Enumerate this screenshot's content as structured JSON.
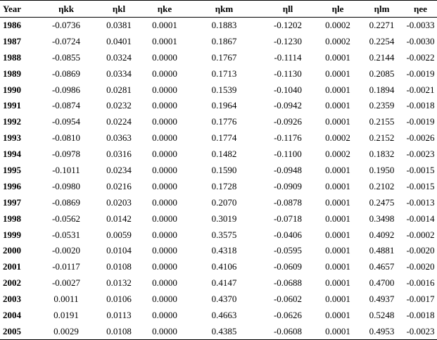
{
  "table": {
    "headers": [
      "Year",
      "ηkk",
      "ηkl",
      "ηke",
      "ηkm",
      "ηll",
      "ηle",
      "ηlm",
      "ηee"
    ],
    "rows": [
      [
        "1986",
        "-0.0736",
        "0.0381",
        "0.0001",
        "0.1883",
        "-0.1202",
        "0.0002",
        "0.2271",
        "-0.0033"
      ],
      [
        "1987",
        "-0.0724",
        "0.0401",
        "0.0001",
        "0.1867",
        "-0.1230",
        "0.0002",
        "0.2254",
        "-0.0030"
      ],
      [
        "1988",
        "-0.0855",
        "0.0324",
        "0.0000",
        "0.1767",
        "-0.1114",
        "0.0001",
        "0.2144",
        "-0.0022"
      ],
      [
        "1989",
        "-0.0869",
        "0.0334",
        "0.0000",
        "0.1713",
        "-0.1130",
        "0.0001",
        "0.2085",
        "-0.0019"
      ],
      [
        "1990",
        "-0.0986",
        "0.0281",
        "0.0000",
        "0.1539",
        "-0.1040",
        "0.0001",
        "0.1894",
        "-0.0021"
      ],
      [
        "1991",
        "-0.0874",
        "0.0232",
        "0.0000",
        "0.1964",
        "-0.0942",
        "0.0001",
        "0.2359",
        "-0.0018"
      ],
      [
        "1992",
        "-0.0954",
        "0.0224",
        "0.0000",
        "0.1776",
        "-0.0926",
        "0.0001",
        "0.2155",
        "-0.0019"
      ],
      [
        "1993",
        "-0.0810",
        "0.0363",
        "0.0000",
        "0.1774",
        "-0.1176",
        "0.0002",
        "0.2152",
        "-0.0026"
      ],
      [
        "1994",
        "-0.0978",
        "0.0316",
        "0.0000",
        "0.1482",
        "-0.1100",
        "0.0002",
        "0.1832",
        "-0.0023"
      ],
      [
        "1995",
        "-0.1011",
        "0.0234",
        "0.0000",
        "0.1590",
        "-0.0948",
        "0.0001",
        "0.1950",
        "-0.0015"
      ],
      [
        "1996",
        "-0.0980",
        "0.0216",
        "0.0000",
        "0.1728",
        "-0.0909",
        "0.0001",
        "0.2102",
        "-0.0015"
      ],
      [
        "1997",
        "-0.0869",
        "0.0203",
        "0.0000",
        "0.2070",
        "-0.0878",
        "0.0001",
        "0.2475",
        "-0.0013"
      ],
      [
        "1998",
        "-0.0562",
        "0.0142",
        "0.0000",
        "0.3019",
        "-0.0718",
        "0.0001",
        "0.3498",
        "-0.0014"
      ],
      [
        "1999",
        "-0.0531",
        "0.0059",
        "0.0000",
        "0.3575",
        "-0.0406",
        "0.0001",
        "0.4092",
        "-0.0002"
      ],
      [
        "2000",
        "-0.0020",
        "0.0104",
        "0.0000",
        "0.4318",
        "-0.0595",
        "0.0001",
        "0.4881",
        "-0.0020"
      ],
      [
        "2001",
        "-0.0117",
        "0.0108",
        "0.0000",
        "0.4106",
        "-0.0609",
        "0.0001",
        "0.4657",
        "-0.0020"
      ],
      [
        "2002",
        "-0.0027",
        "0.0132",
        "0.0000",
        "0.4147",
        "-0.0688",
        "0.0001",
        "0.4700",
        "-0.0016"
      ],
      [
        "2003",
        "0.0011",
        "0.0106",
        "0.0000",
        "0.4370",
        "-0.0602",
        "0.0001",
        "0.4937",
        "-0.0017"
      ],
      [
        "2004",
        "0.0191",
        "0.0113",
        "0.0000",
        "0.4663",
        "-0.0626",
        "0.0001",
        "0.5248",
        "-0.0018"
      ],
      [
        "2005",
        "0.0029",
        "0.0108",
        "0.0000",
        "0.4385",
        "-0.0608",
        "0.0001",
        "0.4953",
        "-0.0023"
      ]
    ]
  },
  "style": {
    "text_color": "#000000",
    "background": "#ffffff",
    "rule_color": "#000000"
  }
}
